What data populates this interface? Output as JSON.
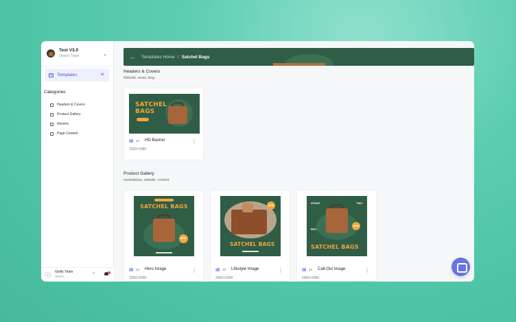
{
  "sidebar": {
    "team_title": "Test V3.0",
    "team_sub": "Omar's Team",
    "active_nav": "Templates",
    "categories_title": "Categories",
    "categories": [
      "Headers & Covers",
      "Product Gallery",
      "Adverts",
      "Page Content"
    ],
    "user_name": "Gloify Team",
    "user_role": "Owner"
  },
  "header": {
    "crumb_home": "Templates Home",
    "separator": "/",
    "crumb_current": "Satchel Bags"
  },
  "sections": [
    {
      "title": "Headers & Covers",
      "subtitle": "Website, email, blog",
      "cards": [
        {
          "name": "HD Banner",
          "count": "12",
          "size": "1920×1080",
          "art_title_line1": "SATCHEL",
          "art_title_line2": "BAGS",
          "art_button": "SHOP NOW"
        }
      ]
    },
    {
      "title": "Product Gallery",
      "subtitle": "marketplace, website, content",
      "cards": [
        {
          "name": "Hero Image",
          "count": "12",
          "size": "2000×2000",
          "art_title": "SATCHEL BAGS",
          "art_badge": "NEW"
        },
        {
          "name": "Lifestyle Image",
          "count": "12",
          "size": "2000×2000",
          "art_title": "SATCHEL BAGS",
          "art_badge": "NEW"
        },
        {
          "name": "Call-Out Image",
          "count": "12",
          "size": "2000×2000",
          "art_title": "SATCHEL BAGS",
          "art_label_1": "STRAP",
          "art_label_2": "TWO",
          "art_label_3": "RETRO",
          "art_badge": "NEW"
        }
      ]
    }
  ],
  "icons": {
    "back": "arrow-left-icon",
    "chat": "chat-icon",
    "bell": "bell-icon",
    "templates": "templates-icon"
  },
  "colors": {
    "background_teal": "#4ec3a6",
    "header_green": "#2f5d45",
    "accent_orange": "#f2a63a",
    "accent_blue": "#4b5fd7",
    "chat_button": "#6675e0"
  }
}
